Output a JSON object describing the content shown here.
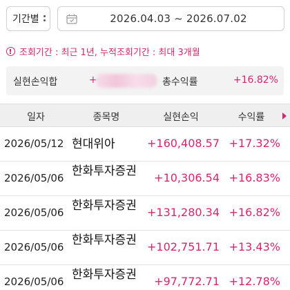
{
  "filter": {
    "period_label": "기간별",
    "date_range": "2026.04.03 ~ 2026.07.02"
  },
  "notice": {
    "text": "조회기간 : 최근 1년, 누적조회기간 : 최대 3개월"
  },
  "summary": {
    "realized_label": "실현손익합",
    "realized_sign": "+",
    "total_return_label": "총수익률",
    "total_return_value": "+16.82%"
  },
  "table": {
    "headers": [
      "일자",
      "종목명",
      "실현손익",
      "수익률"
    ],
    "rows": [
      {
        "date": "2026/05/12",
        "name": "현대위아",
        "pnl": "+160,408.57",
        "rate": "+17.32%"
      },
      {
        "date": "2026/05/06",
        "name": "한화투자증권",
        "pnl": "+10,306.54",
        "rate": "+16.83%"
      },
      {
        "date": "2026/05/06",
        "name": "한화투자증권",
        "pnl": "+131,280.34",
        "rate": "+16.82%"
      },
      {
        "date": "2026/05/06",
        "name": "한화투자증권",
        "pnl": "+102,751.71",
        "rate": "+13.43%"
      },
      {
        "date": "2026/05/06",
        "name": "한화투자증권",
        "pnl": "+97,772.71",
        "rate": "+12.78%"
      }
    ]
  },
  "colors": {
    "accent": "#d6246e",
    "header_bg": "#efefef",
    "summary_bg": "#f3f3f3"
  }
}
